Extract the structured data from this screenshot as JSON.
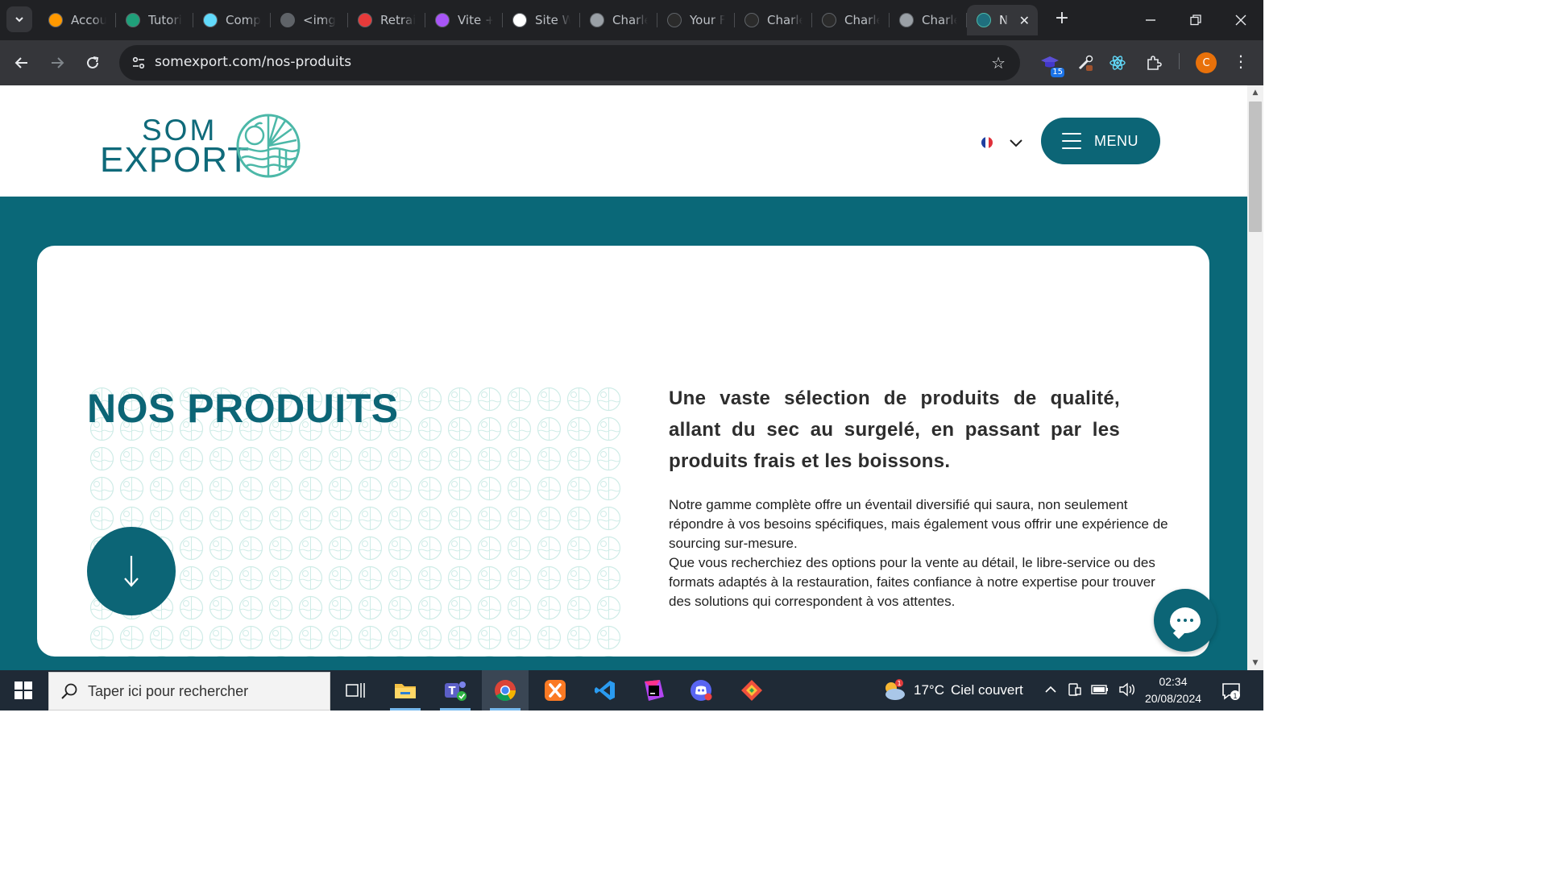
{
  "browser": {
    "tabs": [
      {
        "label": "Accou",
        "icon": "amazon-icon",
        "color": "#ff9900"
      },
      {
        "label": "Tutori",
        "icon": "w-logo-icon",
        "color": "#1fa07a"
      },
      {
        "label": "Comp",
        "icon": "react-icon",
        "color": "#61dafb"
      },
      {
        "label": "<img",
        "icon": "m-logo-icon",
        "color": "#5f6368"
      },
      {
        "label": "Retrai",
        "icon": "retraite-icon",
        "color": "#e63a3a"
      },
      {
        "label": "Vite +",
        "icon": "vite-icon",
        "color": "#a855f7"
      },
      {
        "label": "Site W",
        "icon": "chatgpt-icon",
        "color": "#ffffff"
      },
      {
        "label": "Charle",
        "icon": "globe-icon",
        "color": "#9aa0a6"
      },
      {
        "label": "Your F",
        "icon": "github-icon",
        "color": "#2b2b2b"
      },
      {
        "label": "Charle",
        "icon": "github-icon",
        "color": "#2b2b2b"
      },
      {
        "label": "Charle",
        "icon": "github-icon",
        "color": "#2b2b2b"
      },
      {
        "label": "Charle",
        "icon": "globe-icon",
        "color": "#9aa0a6"
      }
    ],
    "active_tab": {
      "label": "N",
      "icon": "globe-icon"
    },
    "url": "somexport.com/nos-produits",
    "extension_badge": "15",
    "profile_initial": "C"
  },
  "site": {
    "logo_line1": "SOM",
    "logo_line2": "EXPORT",
    "language": "fr",
    "menu_label": "MENU",
    "brand_color": "#0c6576",
    "accent_color": "#4cb8a8"
  },
  "hero": {
    "title": "NOS PRODUITS",
    "lead": "Une vaste sélection de produits de qualité, allant du sec au surgelé, en passant par les produits frais et les boissons.",
    "paragraph1": "Notre gamme complète offre un éventail diversifié qui saura, non seulement répondre à vos besoins spécifiques, mais également vous offrir une expérience de sourcing sur-mesure.",
    "paragraph2": "Que vous recherchiez des options pour la vente au détail, le libre-service ou des formats adaptés à la restauration, faites confiance à notre expertise pour trouver des solutions qui correspondent à vos attentes."
  },
  "taskbar": {
    "search_placeholder": "Taper ici pour rechercher",
    "weather_badge": "1",
    "temperature": "17°C",
    "weather_desc": "Ciel couvert",
    "time": "02:34",
    "date": "20/08/2024",
    "notification_count": "1"
  }
}
